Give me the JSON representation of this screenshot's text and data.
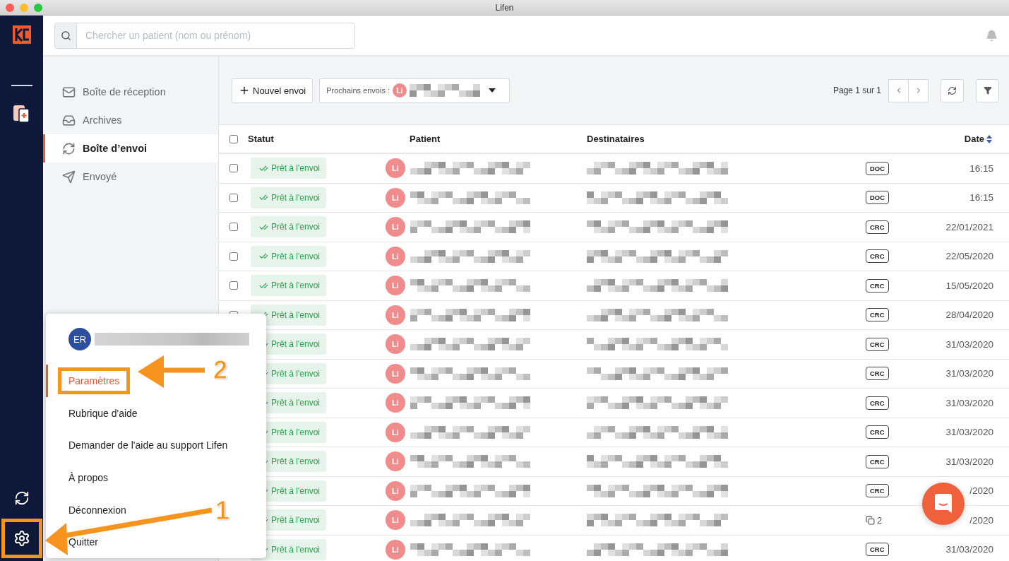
{
  "window": {
    "title": "Lifen"
  },
  "search": {
    "placeholder": "Chercher un patient (nom ou prénom)"
  },
  "sidebar": {
    "items": [
      {
        "kind": "inbox",
        "label": "Boîte de réception",
        "selected": false
      },
      {
        "kind": "archive",
        "label": "Archives",
        "selected": false
      },
      {
        "kind": "outbox",
        "label": "Boîte d’envoi",
        "selected": true
      },
      {
        "kind": "sent",
        "label": "Envoyé",
        "selected": false
      }
    ]
  },
  "toolbar": {
    "new_button": "Nouvel envoi",
    "next_sends": {
      "label": "Prochains envois :",
      "avatar": "Li"
    },
    "pagination": "Page 1 sur 1"
  },
  "table": {
    "select_all": {
      "checked": false
    },
    "columns": [
      "Statut",
      "Patient",
      "Destinataires",
      "Date"
    ],
    "rows": [
      {
        "checked": false,
        "status": "Prêt à l'envoi",
        "avatar": "Li",
        "tag": {
          "kind": "badge",
          "text": "DOC"
        },
        "date": "16:15"
      },
      {
        "checked": false,
        "status": "Prêt à l'envoi",
        "avatar": "Li",
        "tag": {
          "kind": "badge",
          "text": "DOC"
        },
        "date": "16:15"
      },
      {
        "checked": false,
        "status": "Prêt à l'envoi",
        "avatar": "Li",
        "tag": {
          "kind": "badge",
          "text": "CRC"
        },
        "date": "22/01/2021"
      },
      {
        "checked": false,
        "status": "Prêt à l'envoi",
        "avatar": "Li",
        "tag": {
          "kind": "badge",
          "text": "CRC"
        },
        "date": "22/05/2020"
      },
      {
        "checked": false,
        "status": "Prêt à l'envoi",
        "avatar": "Li",
        "tag": {
          "kind": "badge",
          "text": "CRC"
        },
        "date": "15/05/2020"
      },
      {
        "checked": false,
        "status": "Prêt à l'envoi",
        "avatar": "Li",
        "tag": {
          "kind": "badge",
          "text": "CRC"
        },
        "date": "28/04/2020"
      },
      {
        "status": "Prêt à l'envoi",
        "avatar": "Li",
        "tag": {
          "kind": "badge",
          "text": "CRC"
        },
        "date": "31/03/2020"
      },
      {
        "status": "Prêt à l'envoi",
        "avatar": "Li",
        "tag": {
          "kind": "badge",
          "text": "CRC"
        },
        "date": "31/03/2020"
      },
      {
        "status": "Prêt à l'envoi",
        "avatar": "Li",
        "tag": {
          "kind": "badge",
          "text": "CRC"
        },
        "date": "31/03/2020"
      },
      {
        "status": "Prêt à l'envoi",
        "avatar": "Li",
        "tag": {
          "kind": "badge",
          "text": "CRC"
        },
        "date": "31/03/2020"
      },
      {
        "status": "Prêt à l'envoi",
        "avatar": "Li",
        "tag": {
          "kind": "badge",
          "text": "CRC"
        },
        "date": "31/03/2020"
      },
      {
        "status": "Prêt à l'envoi",
        "avatar": "Li",
        "tag": {
          "kind": "badge",
          "text": "CRC"
        },
        "date": "/2020"
      },
      {
        "status": "Prêt à l'envoi",
        "avatar": "Li",
        "tag": {
          "kind": "count",
          "text": "2"
        },
        "date": "/2020"
      },
      {
        "status": "Prêt à l'envoi",
        "avatar": "Li",
        "tag": {
          "kind": "badge",
          "text": "CRC"
        },
        "date": "31/03/2020"
      }
    ]
  },
  "user_menu": {
    "initials": "ER",
    "items": [
      {
        "label": "Paramètres",
        "selected": true
      },
      {
        "label": "Rubrique d'aide",
        "selected": false
      },
      {
        "label": "Demander de l'aide au support Lifen",
        "selected": false
      },
      {
        "label": "À propos",
        "selected": false
      },
      {
        "label": "Déconnexion",
        "selected": false
      },
      {
        "label": "Quitter",
        "selected": false
      }
    ]
  },
  "annotations": [
    {
      "label": "2"
    },
    {
      "label": "1"
    }
  ]
}
